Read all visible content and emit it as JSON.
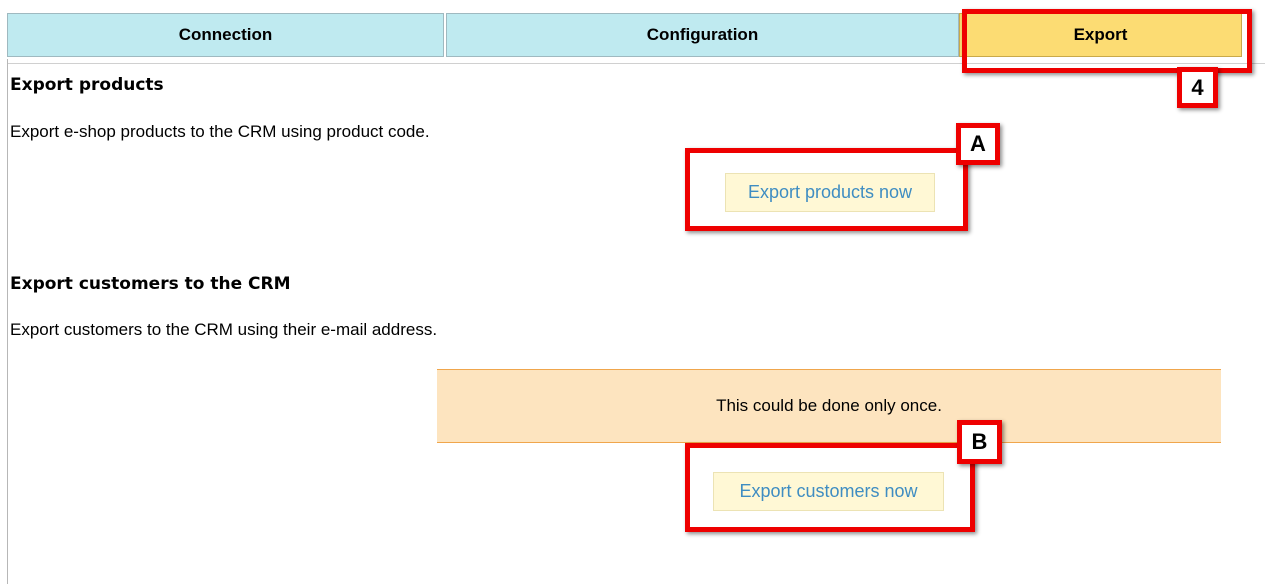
{
  "tabs": [
    {
      "label": "Connection"
    },
    {
      "label": "Configuration"
    },
    {
      "label": "Export"
    }
  ],
  "export_products": {
    "heading": "Export products",
    "description": "Export e-shop products to the CRM using product code.",
    "button_label": "Export products now"
  },
  "export_customers": {
    "heading": "Export customers to the CRM",
    "description": "Export customers to the CRM using their e-mail address.",
    "warning": "This could be done only once.",
    "button_label": "Export customers now"
  },
  "annotations": {
    "tab_marker": "4",
    "products_marker": "A",
    "customers_marker": "B"
  },
  "colors": {
    "tab_inactive": "#bfeaf0",
    "tab_active": "#fcdc73",
    "button_bg": "#fff8d5",
    "button_text": "#3f8dc2",
    "warning_bg": "#fde4bf",
    "highlight": "#ee0000"
  }
}
